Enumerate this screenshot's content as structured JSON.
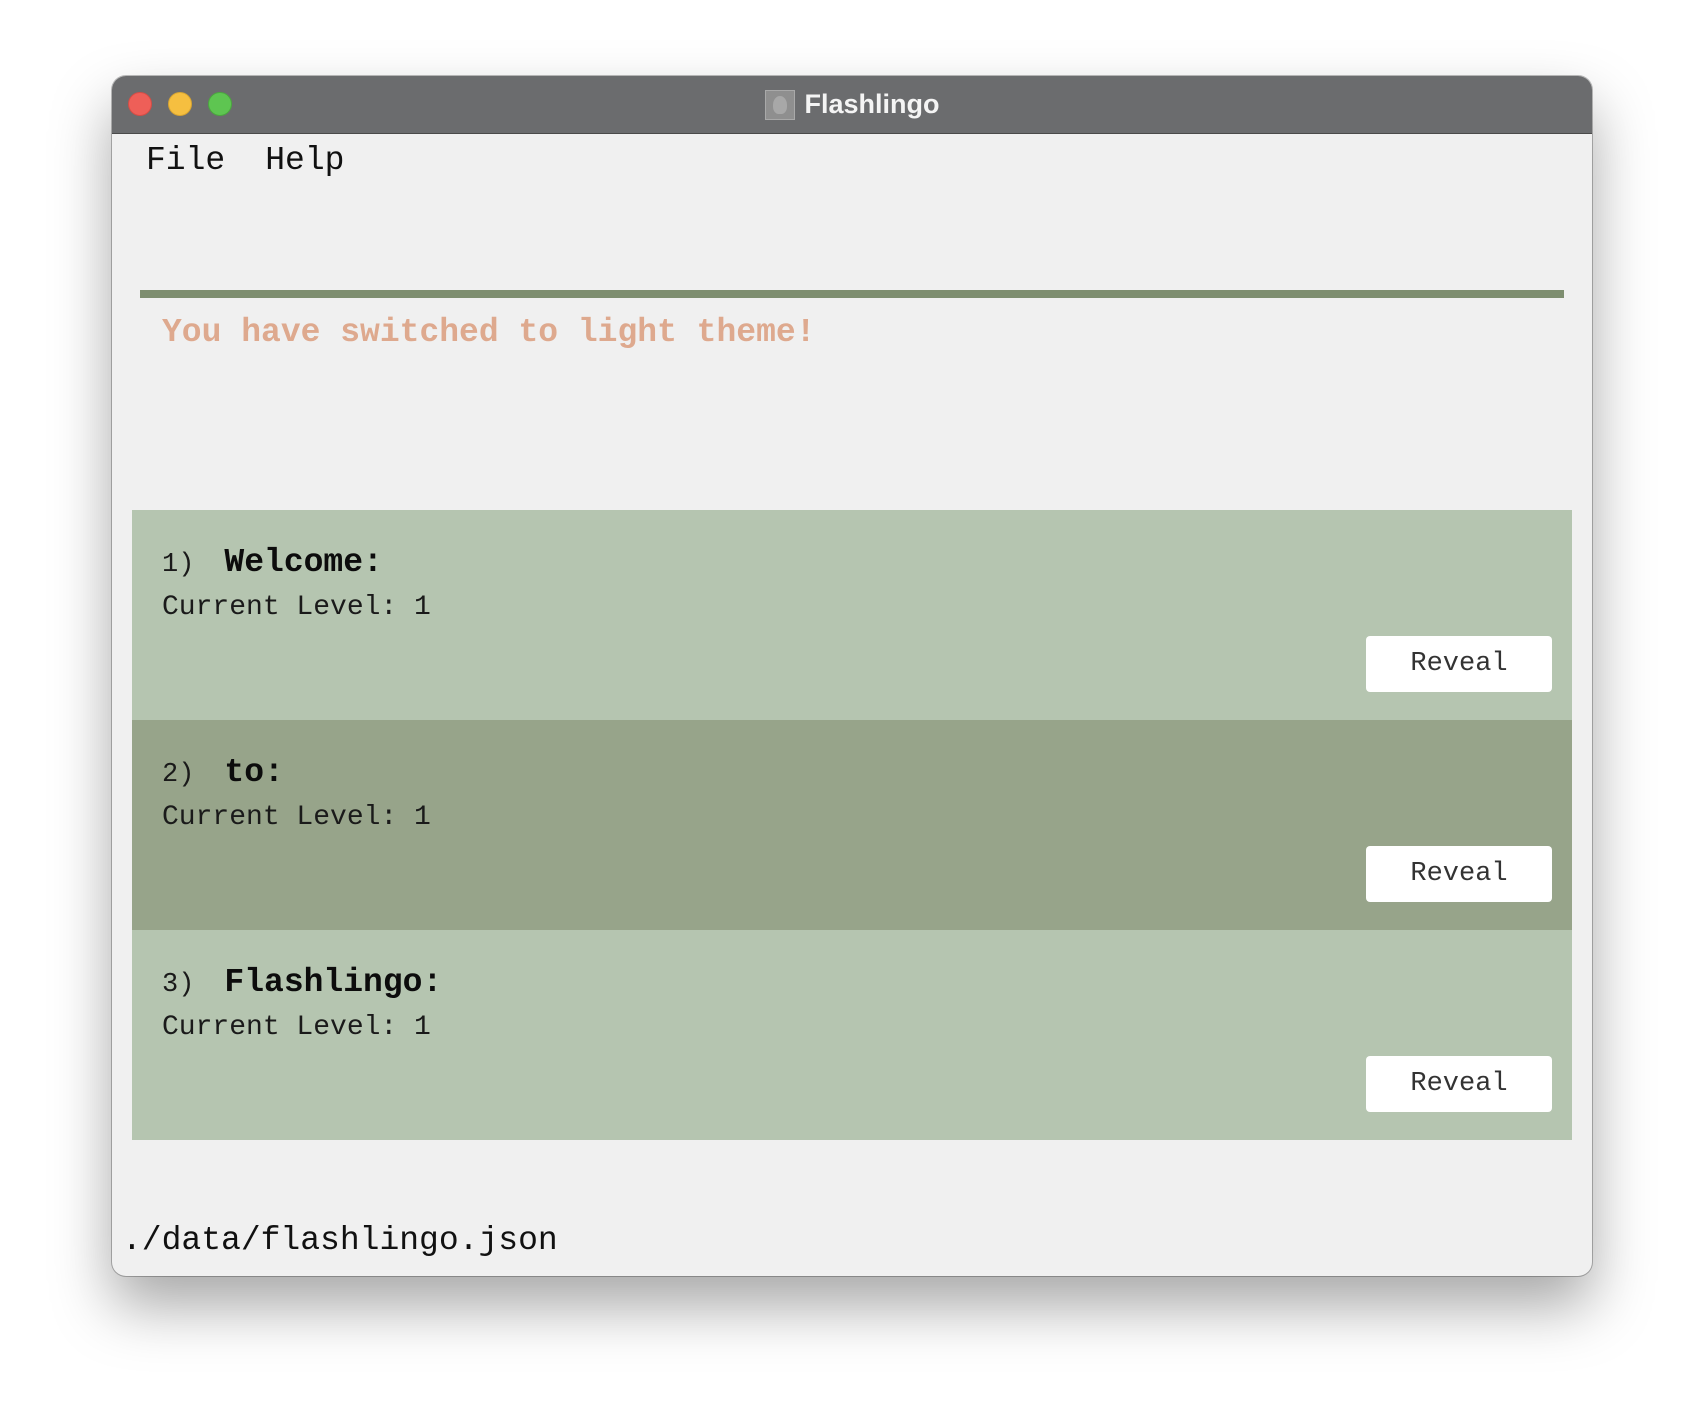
{
  "window": {
    "title": "Flashlingo",
    "app_icon": "flashlingo-app-icon"
  },
  "menu": {
    "items": [
      {
        "label": "File"
      },
      {
        "label": "Help"
      }
    ]
  },
  "result_message": "You have switched to light theme!",
  "flashcards": [
    {
      "index": "1)",
      "word": "Welcome:",
      "level": "Current Level: 1",
      "button": "Reveal"
    },
    {
      "index": "2)",
      "word": "to:",
      "level": "Current Level: 1",
      "button": "Reveal"
    },
    {
      "index": "3)",
      "word": "Flashlingo:",
      "level": "Current Level: 1",
      "button": "Reveal"
    }
  ],
  "status_bar": {
    "file_path": "./data/flashlingo.json"
  },
  "colors": {
    "result_text": "#dea98e",
    "divider": "#7e8e70",
    "card_light": "#b5c5b0",
    "card_dark": "#97a48a"
  }
}
